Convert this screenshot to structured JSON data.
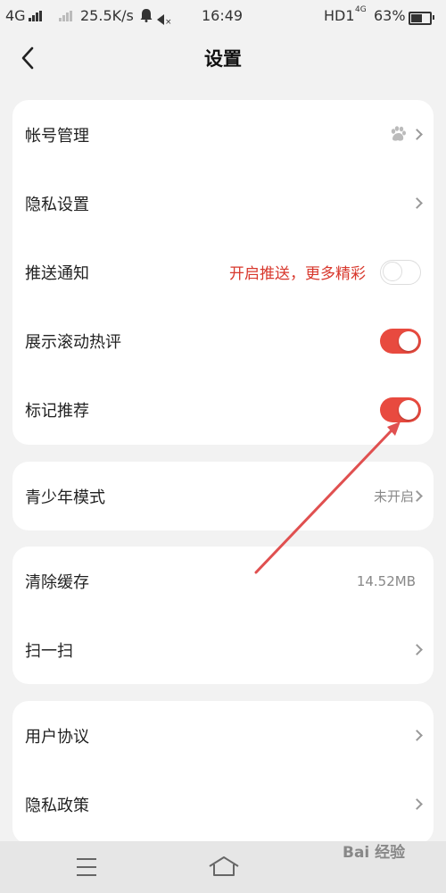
{
  "status_bar": {
    "network": "4G",
    "speed": "25.5K/s",
    "time": "16:49",
    "hd": "HD1",
    "network2": "4G",
    "battery": "63%"
  },
  "header": {
    "title": "设置"
  },
  "groups": [
    {
      "rows": [
        {
          "label": "帐号管理",
          "trailing": "baidu-paw-icon + chevron"
        },
        {
          "label": "隐私设置",
          "trailing": "chevron"
        },
        {
          "label": "推送通知",
          "promo": "开启推送，更多精彩",
          "toggle": false
        },
        {
          "label": "展示滚动热评",
          "toggle": true
        },
        {
          "label": "标记推荐",
          "toggle": true
        }
      ]
    },
    {
      "rows": [
        {
          "label": "青少年模式",
          "value": "未开启"
        }
      ]
    },
    {
      "rows": [
        {
          "label": "清除缓存",
          "value": "14.52MB"
        },
        {
          "label": "扫一扫"
        }
      ]
    },
    {
      "rows": [
        {
          "label": "用户协议"
        },
        {
          "label": "隐私政策"
        }
      ]
    }
  ],
  "watermark": "Bai 经验",
  "colors": {
    "accent": "#e84a3f",
    "promo": "#d8382d",
    "annotation_arrow": "#e05050"
  },
  "icons": {
    "back": "back-chevron-icon",
    "account": "baidu-paw-icon",
    "nav_menu": "menu-icon",
    "nav_home": "home-icon"
  }
}
